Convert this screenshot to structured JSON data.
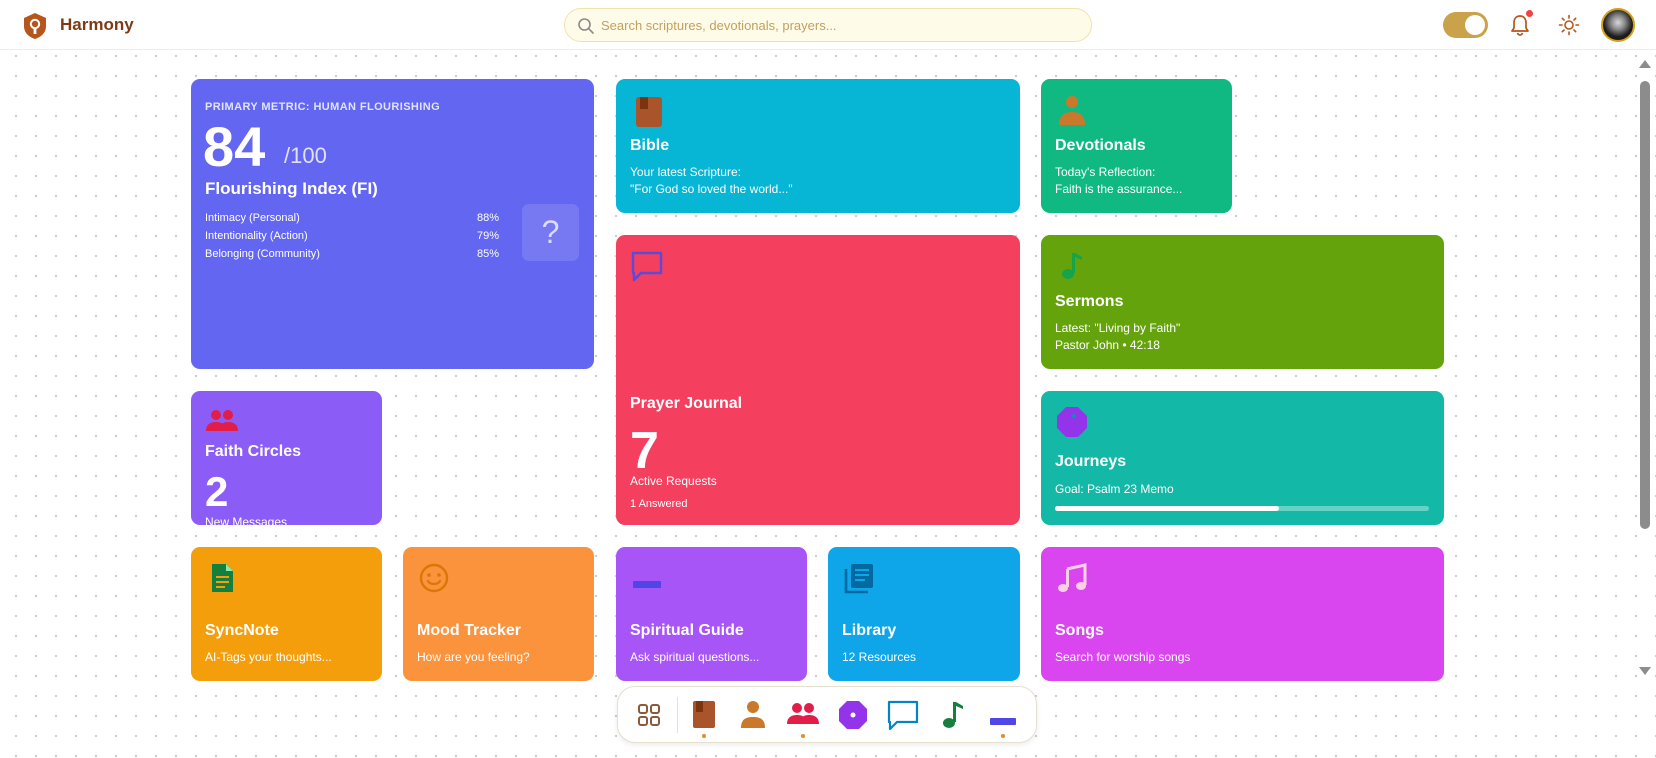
{
  "header": {
    "app_name": "Harmony",
    "search_placeholder": "Search scriptures, devotionals, prayers...",
    "brand_color": "#7c3b14"
  },
  "flourishing": {
    "kicker": "PRIMARY METRIC: HUMAN FLOURISHING",
    "score": "84",
    "out_of": "/100",
    "index_name": "Flourishing Index (FI)",
    "rows": [
      {
        "label": "Intimacy (Personal)",
        "value": "88%"
      },
      {
        "label": "Intentionality (Action)",
        "value": "79%"
      },
      {
        "label": "Belonging (Community)",
        "value": "85%"
      }
    ],
    "help_glyph": "?",
    "color": "#6366f1"
  },
  "tiles": {
    "bible": {
      "title": "Bible",
      "line1": "Your latest Scripture:",
      "line2": "\"For God so loved the world...\"",
      "color": "#06b6d4",
      "icon": "book-icon"
    },
    "devotionals": {
      "title": "Devotionals",
      "line1": "Today's Reflection:",
      "line2": "Faith is the assurance...",
      "color": "#10b981",
      "icon": "person-icon"
    },
    "prayer": {
      "title": "Prayer Journal",
      "count": "7",
      "count_label": "Active Requests",
      "answered": "1 Answered",
      "color": "#f43f5e",
      "icon": "chat-bubble-icon"
    },
    "sermons": {
      "title": "Sermons",
      "line1": "Latest: \"Living by Faith\"",
      "line2": "Pastor John • 42:18",
      "color": "#65a30d",
      "icon": "music-note-icon"
    },
    "circles": {
      "title": "Faith Circles",
      "count": "2",
      "count_label": "New Messages",
      "color": "#8b5cf6",
      "icon": "group-icon"
    },
    "journeys": {
      "title": "Journeys",
      "line1": "Goal: Psalm 23 Memo",
      "progress": 0.6,
      "color": "#14b8a6",
      "icon": "octagon-icon"
    },
    "syncnote": {
      "title": "SyncNote",
      "line1": "AI-Tags your thoughts...",
      "color": "#f59e0b",
      "icon": "document-icon"
    },
    "mood": {
      "title": "Mood Tracker",
      "line1": "How are you feeling?",
      "color": "#fb923c",
      "icon": "smiley-icon"
    },
    "guide": {
      "title": "Spiritual Guide",
      "line1": "Ask spiritual questions...",
      "color": "#a855f7",
      "icon": "bar-icon"
    },
    "library": {
      "title": "Library",
      "line1": "12 Resources",
      "color": "#0ea5e9",
      "icon": "library-icon"
    },
    "songs": {
      "title": "Songs",
      "line1": "Search for worship songs",
      "color": "#d946ef",
      "icon": "music-icon"
    }
  },
  "dock": {
    "items": [
      "grid-icon",
      "book-icon",
      "person-icon",
      "group-icon",
      "octagon-icon",
      "chat-bubble-icon",
      "music-note-icon",
      "bar-icon"
    ]
  }
}
